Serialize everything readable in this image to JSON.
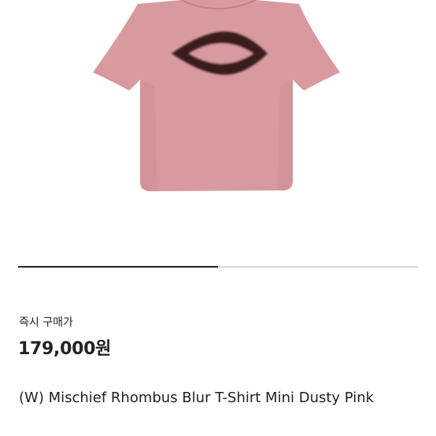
{
  "product": {
    "image_alt": "Pink cropped t-shirt with dark rhombus logo",
    "colors": {
      "shirt": "#d89a9f",
      "shirt_shadow": "#c98a90",
      "logo": "#3a1f1d",
      "background": "#ffffff"
    },
    "gallery_progress": 0.5,
    "instant_purchase_label": "즉시 구매가",
    "price": "179,000원",
    "name": "(W) Mischief Rhombus Blur T-Shirt Mini Dusty Pink",
    "subtitle": ""
  }
}
